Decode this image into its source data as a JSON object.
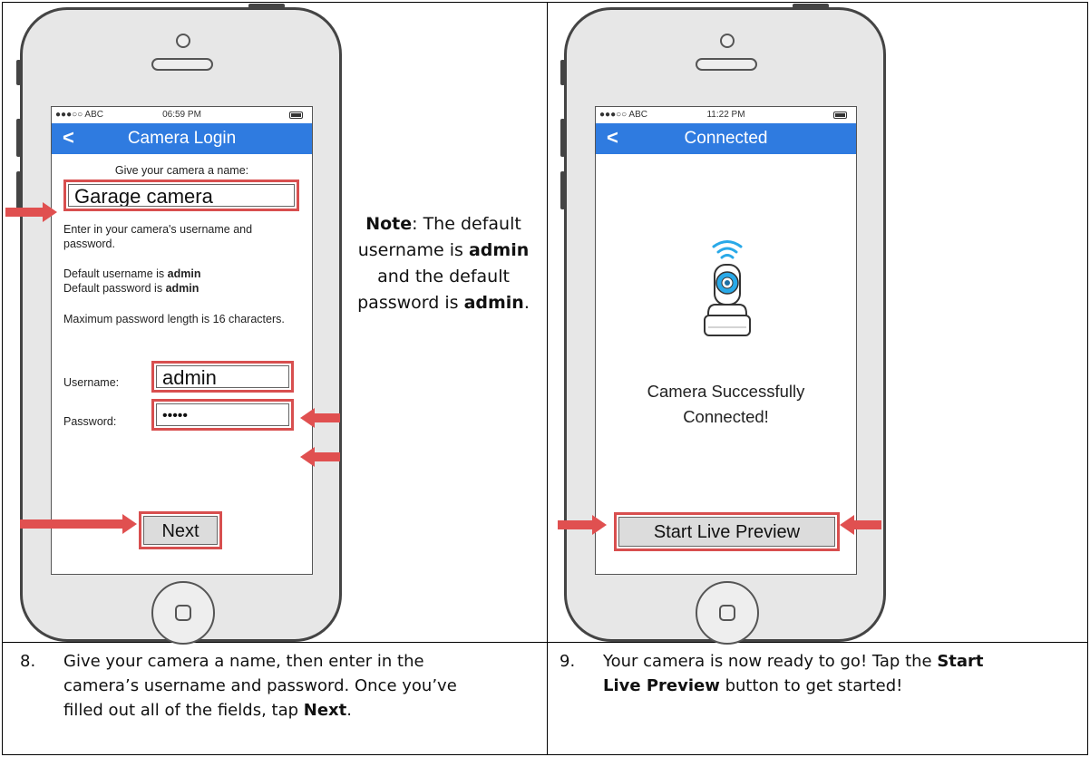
{
  "note": {
    "label": "Note",
    "text1": ": The default username is ",
    "bold1": "admin",
    "text2": " and the default password is ",
    "bold2": "admin",
    "text3": "."
  },
  "left_phone": {
    "status": {
      "carrier": "●●●○○ ABC",
      "time": "06:59 PM"
    },
    "nav": {
      "back": "<",
      "title": "Camera Login"
    },
    "name_prompt": "Give your camera a name:",
    "camera_name_value": "Garage camera",
    "instructions": "Enter in your camera's username and password.",
    "default_user_prefix": "Default username is ",
    "default_user_value": "admin",
    "default_pass_prefix": "Default password is ",
    "default_pass_value": "admin",
    "max_length_text": "Maximum password length is 16 characters.",
    "username_label": "Username:",
    "username_value": "admin",
    "password_label": "Password:",
    "password_value": "•••••",
    "next_button": "Next"
  },
  "right_phone": {
    "status": {
      "carrier": "●●●○○ ABC",
      "time": "11:22 PM"
    },
    "nav": {
      "back": "<",
      "title": "Connected"
    },
    "success_line1": "Camera Successfully",
    "success_line2": "Connected!",
    "start_button": "Start Live Preview",
    "camera_icon": "camera-icon",
    "wifi_icon": "wifi-icon"
  },
  "captions": {
    "step8": {
      "number": "8.",
      "line1": "Give your camera a name, then enter in the",
      "line2": "camera’s username and password. Once you’ve",
      "line3_prefix": "filled out all of the fields, tap ",
      "line3_bold": "Next",
      "line3_suffix": "."
    },
    "step9": {
      "number": "9.",
      "line1_prefix": "Your camera is now ready to go! Tap the ",
      "line1_bold": "Start",
      "line2_bold": "Live Preview",
      "line2_suffix": " button to get started!"
    }
  },
  "colors": {
    "nav_blue": "#2f7be0",
    "highlight_red": "#d84f4f",
    "camera_blue": "#29a9e8"
  }
}
